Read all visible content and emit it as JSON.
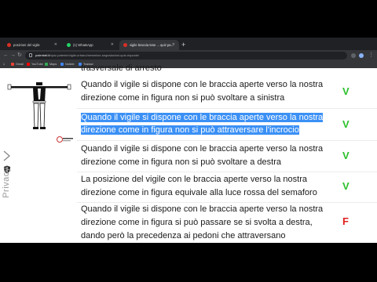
{
  "browser": {
    "tabs": [
      {
        "label": "posizioni del vigile",
        "favicon_color": "#d93025"
      },
      {
        "label": "(1) WhatsApp",
        "favicon_color": "#25d366"
      },
      {
        "label": "vigile braccia tese ... quiz pa...",
        "favicon_color": "#d93025"
      }
    ],
    "new_tab_symbol": "+",
    "address": {
      "domain": "patentati.it",
      "path": "/quiz-patente/vigile-urbano/semaforo-segnalazioni-quiz-risposte/"
    },
    "bookmarks": [
      {
        "label": "Gmail",
        "icon_color": "#ea4335"
      },
      {
        "label": "YouTube",
        "icon_color": "#ff0000"
      },
      {
        "label": "Maps",
        "icon_color": "#34a853"
      },
      {
        "label": "Notizie",
        "icon_color": "#4285f4"
      },
      {
        "label": "Traduci",
        "icon_color": "#4285f4"
      }
    ]
  },
  "sidebar": {
    "privacy_label": "Privacy"
  },
  "quiz": {
    "partial_top": "trasversale di arresto",
    "items": [
      {
        "lines": [
          "Quando il vigile si dispone con le braccia aperte verso la nostra",
          "direzione come in figura non si può svoltare a sinistra"
        ],
        "answer": "V",
        "highlighted": false
      },
      {
        "lines": [
          "Quando il vigile si dispone con le braccia aperte verso la nostra",
          "direzione come in figura non si può attraversare l'incrocio"
        ],
        "answer": "V",
        "highlighted": true
      },
      {
        "lines": [
          "Quando il vigile si dispone con le braccia aperte verso la nostra",
          "direzione come in figura non si può svoltare a destra"
        ],
        "answer": "V",
        "highlighted": false
      },
      {
        "lines": [
          "La posizione del vigile con le braccia aperte verso la nostra",
          "direzione come in figura equivale alla luce rossa del semaforo"
        ],
        "answer": "V",
        "highlighted": false
      },
      {
        "lines": [
          "Quando il vigile si dispone con le braccia aperte verso la nostra",
          "direzione come in figura si può passare se si svolta a destra,",
          "dando però la precedenza ai pedoni che attraversano"
        ],
        "answer": "F",
        "highlighted": false
      }
    ]
  },
  "colors": {
    "true_answer": "#2bc02b",
    "false_answer": "#e21d1d",
    "selection": "#3b90f5"
  }
}
